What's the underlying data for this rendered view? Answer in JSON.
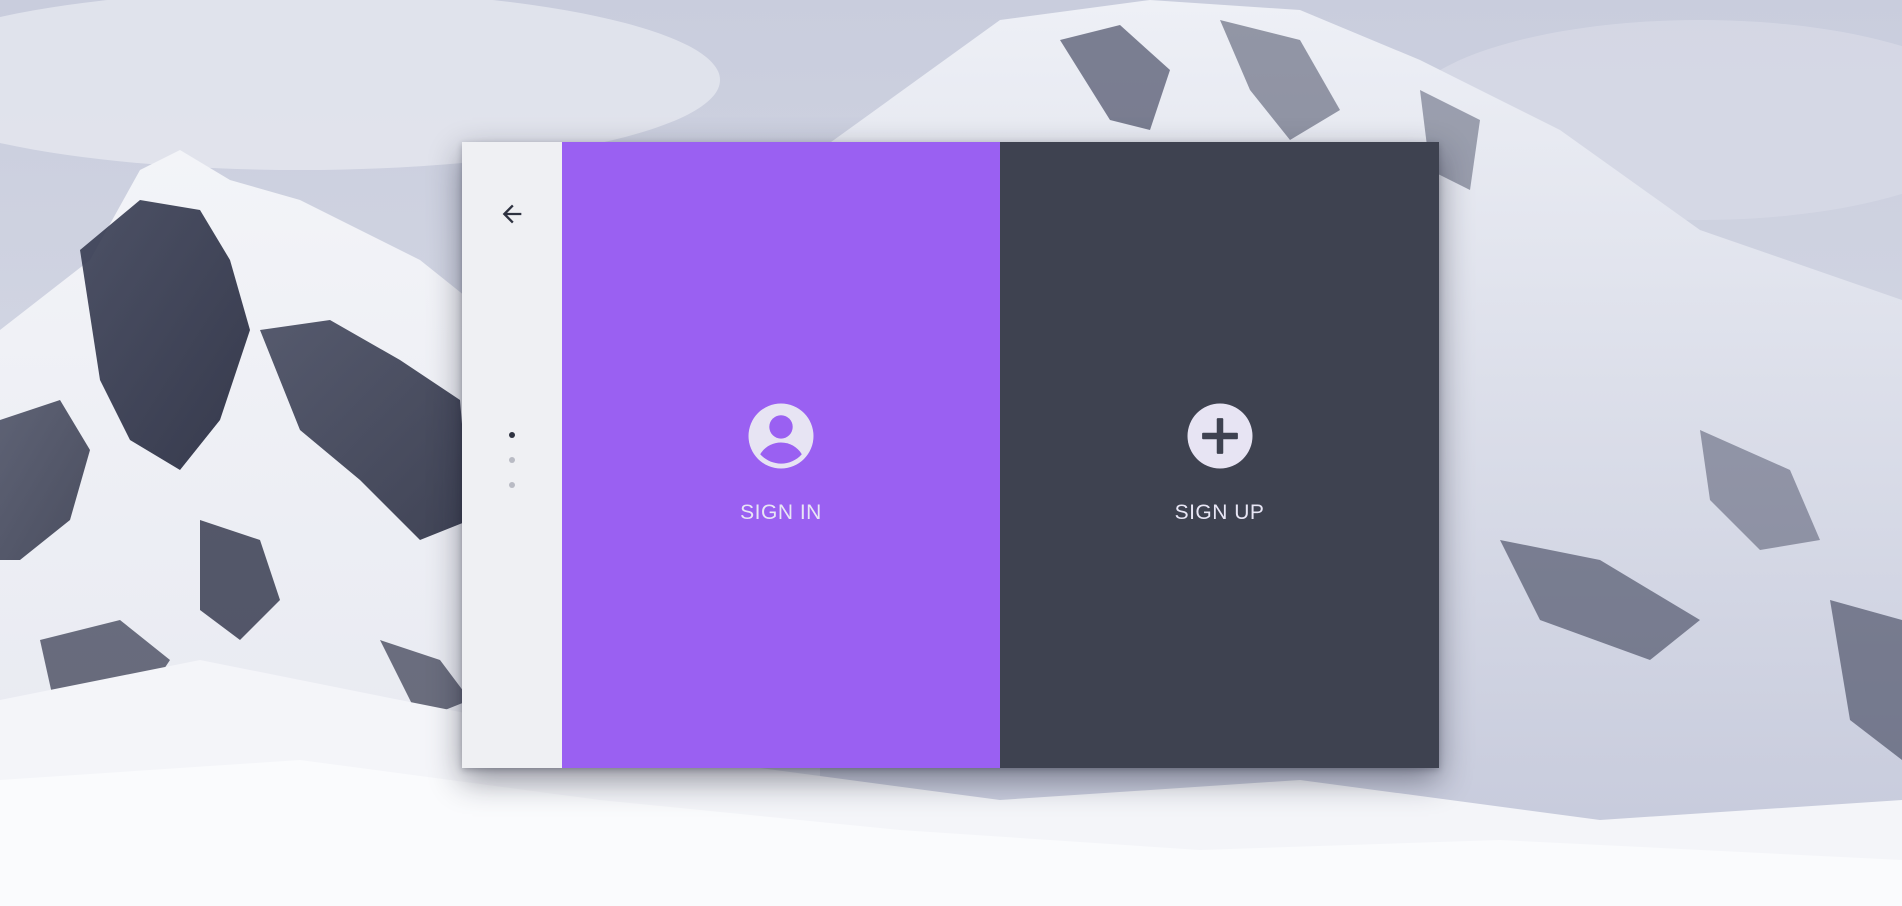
{
  "background": {
    "subject": "snowy-mountain-photo"
  },
  "colors": {
    "signin_panel": "#9a60f2",
    "signup_panel": "#3e4250",
    "side_rail": "#eff0f3",
    "label_text": "#e8e6f5"
  },
  "nav": {
    "back_icon": "arrow-left-icon",
    "steps": [
      {
        "active": true
      },
      {
        "active": false
      },
      {
        "active": false
      }
    ]
  },
  "options": {
    "signin": {
      "label": "SIGN IN",
      "icon": "account-circle-icon"
    },
    "signup": {
      "label": "SIGN UP",
      "icon": "add-circle-icon"
    }
  }
}
